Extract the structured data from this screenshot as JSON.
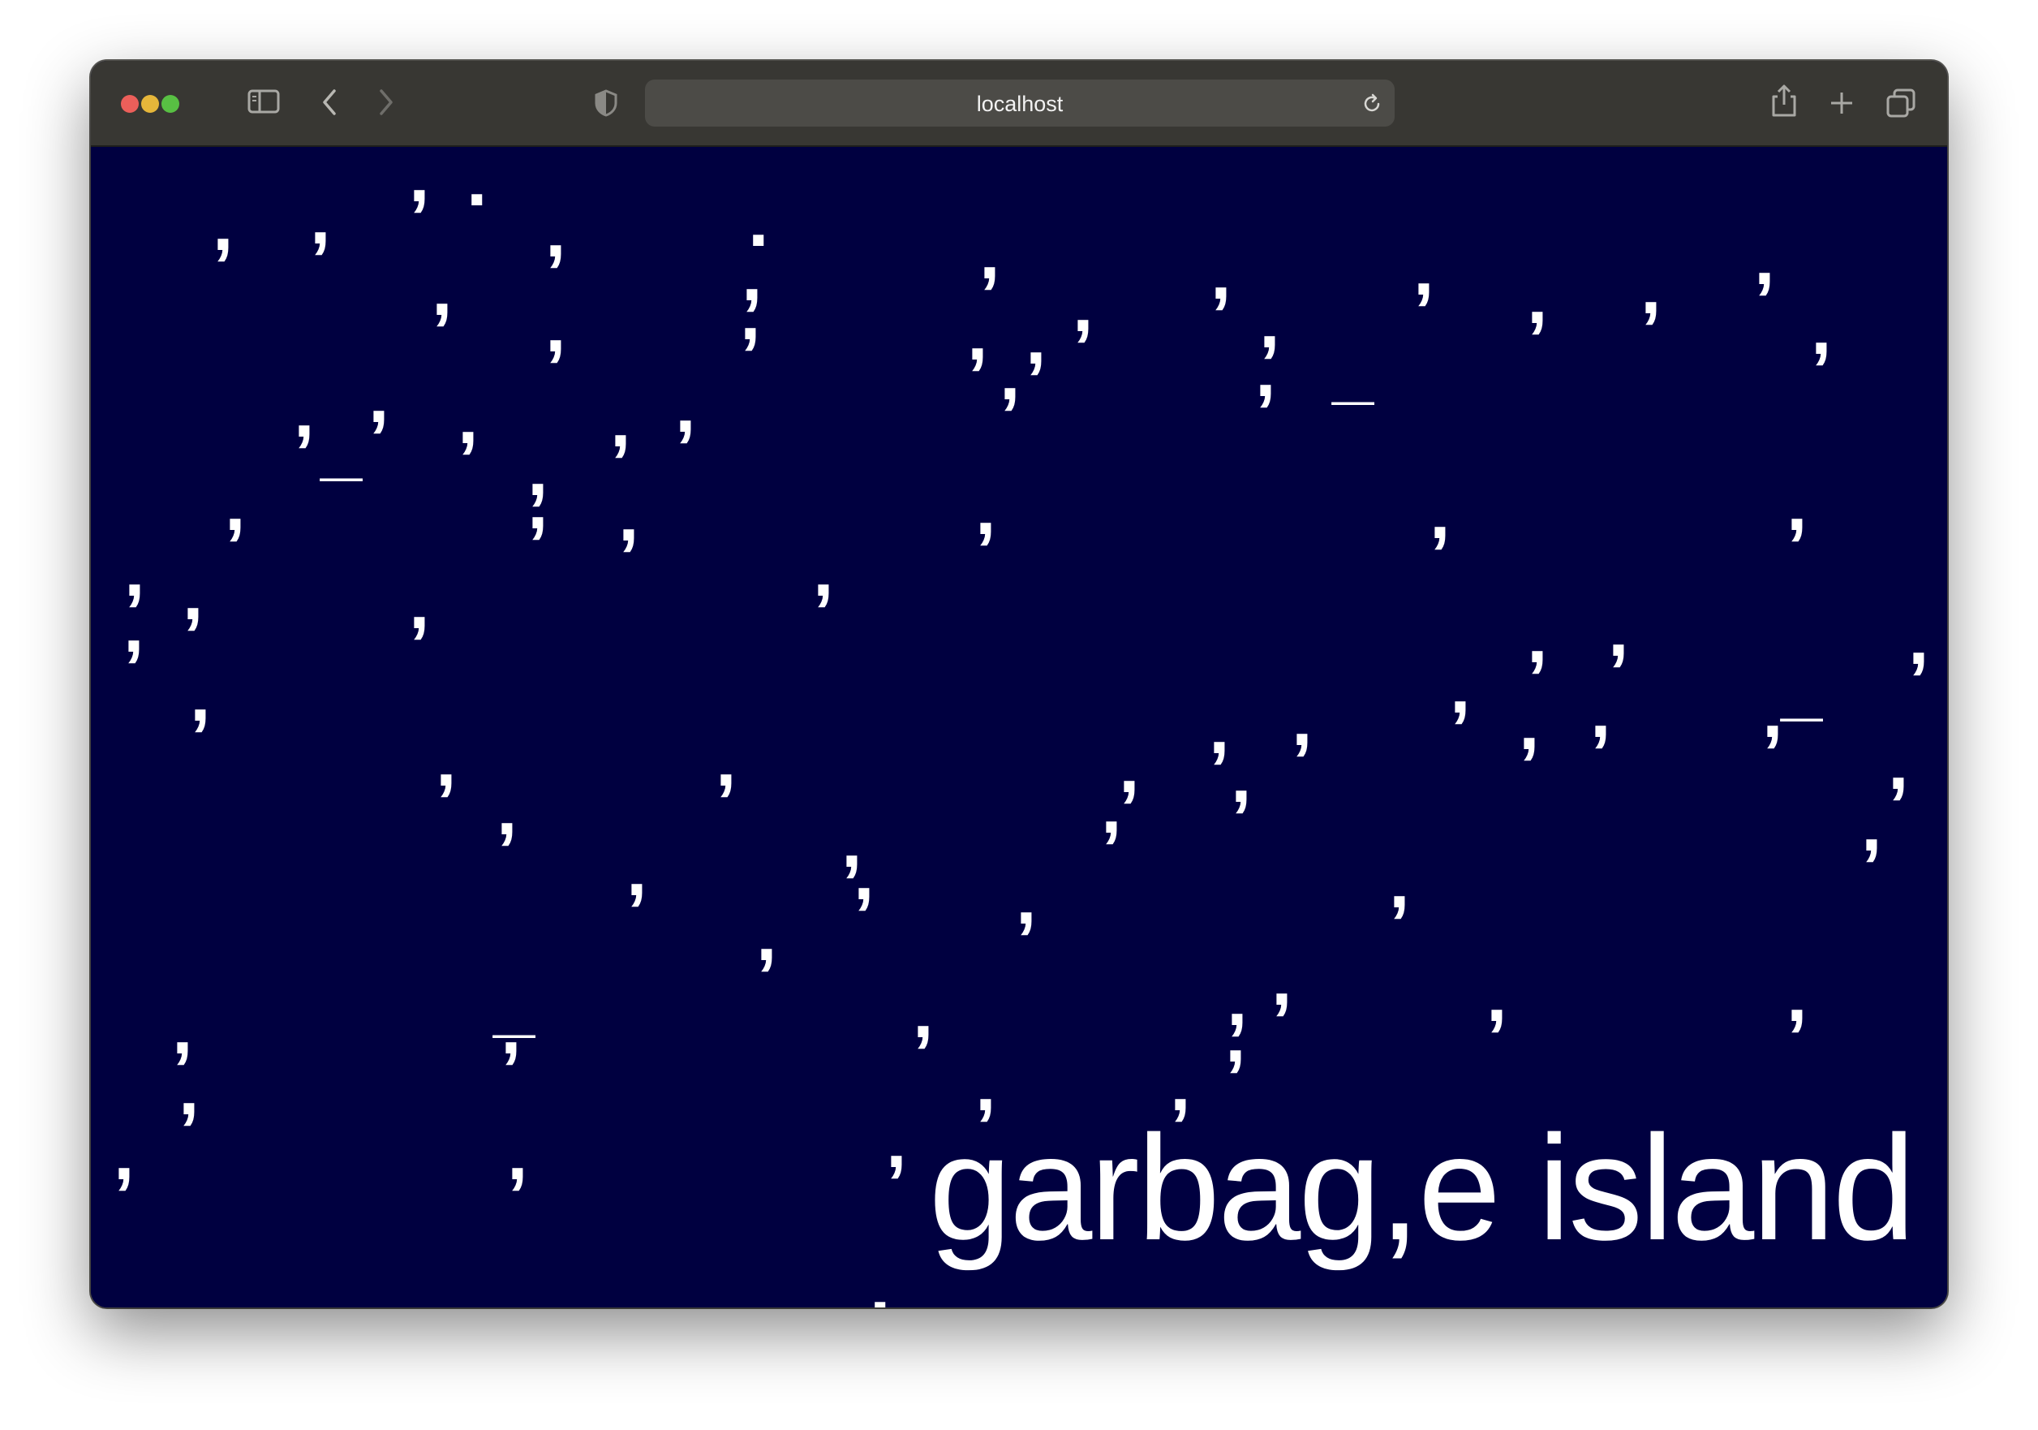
{
  "browser": {
    "url": "localhost"
  },
  "page": {
    "title": "garbag,e island",
    "background_color": "#000040",
    "text_color": "#ffffff"
  },
  "icons": {
    "sidebar": "sidebar-icon",
    "back": "chevron-left-icon",
    "forward": "chevron-right-icon",
    "privacy": "shield-icon",
    "reload": "reload-icon",
    "share": "share-icon",
    "new_tab": "plus-icon",
    "tabs": "tab-overview-icon"
  },
  "falling_characters": [
    ",",
    ",",
    ",",
    ",",
    ",",
    ",",
    ",",
    ",",
    ",",
    ",",
    ",",
    ",",
    ",",
    ",",
    ",",
    ",",
    ",",
    ",",
    ",",
    ",",
    ",",
    ",",
    ",",
    ",",
    ",",
    ",",
    ",",
    ",",
    ",",
    ",",
    ",",
    ",",
    ",",
    ",",
    ",",
    ",",
    ",",
    ",",
    ",",
    ",",
    ",",
    ",",
    ",",
    ",",
    ",",
    ",",
    ",",
    ",",
    ",",
    ",",
    ",",
    ",",
    ",",
    ",",
    ",",
    ",",
    ",",
    ",",
    ",",
    ",",
    ",",
    ",",
    ",",
    ",",
    ",",
    ",",
    ",",
    ",",
    ",",
    ",",
    ",",
    ",",
    ",",
    ",",
    ",",
    ",",
    ",",
    "_",
    "_",
    "_",
    "_",
    "-",
    ".",
    ".",
    ".",
    ";",
    ":",
    ","
  ]
}
